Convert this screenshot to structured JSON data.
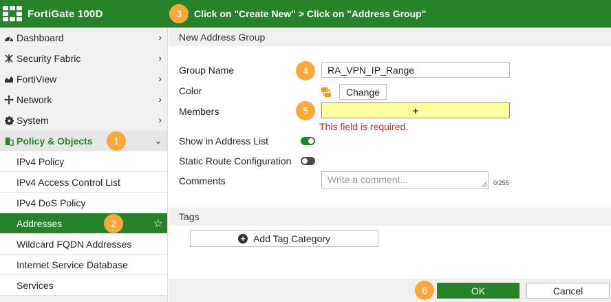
{
  "app": {
    "title": "FortiGate 100D",
    "instruction_step": "3",
    "instruction": "Click on \"Create New\" > Click on \"Address Group\""
  },
  "colors": {
    "brand_green": "#27822a",
    "badge_orange": "#f7a93b",
    "error_red": "#b8332e",
    "required_yellow": "#ffff9f"
  },
  "sidebar": {
    "items": [
      {
        "label": "Dashboard",
        "icon": "dashboard-icon"
      },
      {
        "label": "Security Fabric",
        "icon": "security-fabric-icon"
      },
      {
        "label": "FortiView",
        "icon": "fortiview-icon"
      },
      {
        "label": "Network",
        "icon": "network-icon"
      },
      {
        "label": "System",
        "icon": "gear-icon"
      },
      {
        "label": "Policy & Objects",
        "icon": "policy-icon",
        "step": "1"
      }
    ],
    "subitems": [
      {
        "label": "IPv4 Policy"
      },
      {
        "label": "IPv4 Access Control List"
      },
      {
        "label": "IPv4 DoS Policy"
      },
      {
        "label": "Addresses",
        "step": "2"
      },
      {
        "label": "Wildcard FQDN Addresses"
      },
      {
        "label": "Internet Service Database"
      },
      {
        "label": "Services"
      }
    ]
  },
  "form": {
    "header": "New Address Group",
    "group_name_label": "Group Name",
    "group_name_value": "RA_VPN_IP_Range",
    "group_name_step": "4",
    "color_label": "Color",
    "change_button": "Change",
    "members_label": "Members",
    "members_add": "+",
    "members_step": "5",
    "members_error": "This field is required.",
    "show_in_list_label": "Show in Address List",
    "show_in_list_on": true,
    "static_route_label": "Static Route Configuration",
    "static_route_on": false,
    "comments_label": "Comments",
    "comments_placeholder": "Write a comment...",
    "comments_counter": "0/255"
  },
  "tags": {
    "header": "Tags",
    "add_button": "Add Tag Category"
  },
  "footer": {
    "ok": "OK",
    "cancel": "Cancel",
    "ok_step": "6"
  }
}
